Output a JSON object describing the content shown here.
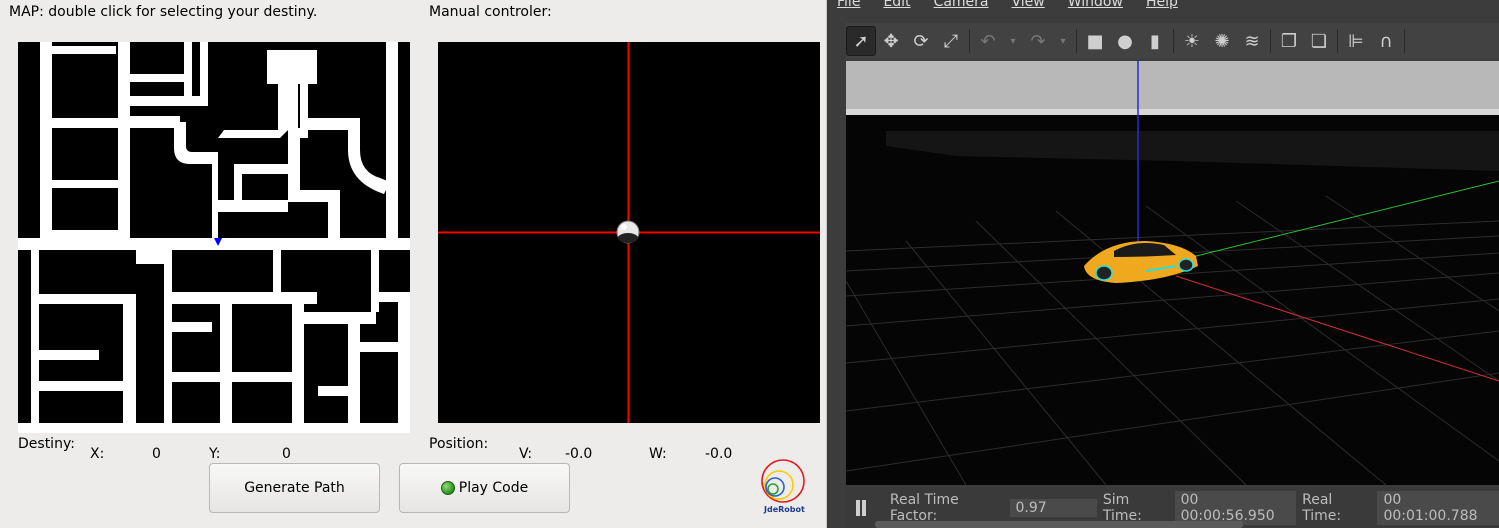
{
  "map_panel": {
    "title": "MAP: double click for selecting your destiny."
  },
  "controller_panel": {
    "title": "Manual controler:"
  },
  "destiny": {
    "label": "Destiny:",
    "x_label": "X:",
    "x_value": "0",
    "y_label": "Y:",
    "y_value": "0"
  },
  "position": {
    "label": "Position:",
    "v_label": "V:",
    "v_value": "-0.0",
    "w_label": "W:",
    "w_value": "-0.0"
  },
  "buttons": {
    "generate_path": "Generate Path",
    "play_code": "Play Code"
  },
  "logo": {
    "text": "JdeRobot",
    "colors": [
      "#e41a1c",
      "#ffcc00",
      "#2a63c9",
      "#2ca02c"
    ]
  },
  "gazebo": {
    "menu": [
      "File",
      "Edit",
      "Camera",
      "View",
      "Window",
      "Help"
    ],
    "toolbar_icons": [
      "select-arrow-icon",
      "translate-icon",
      "rotate-icon",
      "scale-icon",
      "undo-icon",
      "undo-dropdown-icon",
      "redo-icon",
      "redo-dropdown-icon",
      "box-icon",
      "sphere-icon",
      "cylinder-icon",
      "sun-light-icon",
      "point-light-icon",
      "spot-light-icon",
      "copy-icon",
      "paste-icon",
      "align-icon",
      "magnet-icon"
    ],
    "status": {
      "rtf_label": "Real Time Factor:",
      "rtf_value": "0.97",
      "sim_label": "Sim Time:",
      "sim_value": "00 00:00:56.950",
      "real_label": "Real Time:",
      "real_value": "00 00:01:00.788"
    },
    "colors": {
      "axis_x": "#d03030",
      "axis_y": "#2fbf2f",
      "axis_z": "#2a2ad8",
      "car_body": "#f0a81e",
      "car_trim": "#27e0e0"
    }
  },
  "map_colors": {
    "road": "#ffffff",
    "block": "#000000",
    "car_marker": "#0000ff"
  },
  "controller_colors": {
    "crosshair": "#ff0000"
  }
}
